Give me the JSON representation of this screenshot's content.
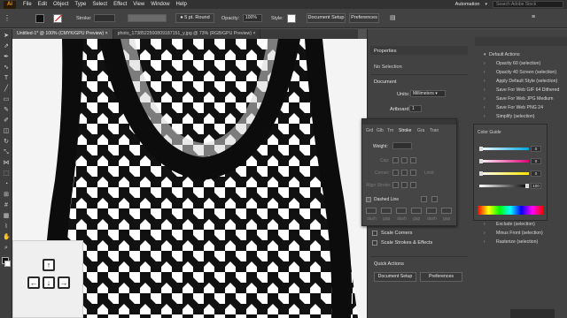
{
  "menu": {
    "logo": "Ai",
    "items": [
      "File",
      "Edit",
      "Object",
      "Type",
      "Select",
      "Effect",
      "View",
      "Window",
      "Help"
    ],
    "workspace": "Automation",
    "search_placeholder": "Search Adobe Stock"
  },
  "control": {
    "stroke_label": "Stroke:",
    "brush_value": "5 pt. Round",
    "opacity_label": "Opacity:",
    "opacity_value": "100%",
    "style_label": "Style:",
    "document_setup": "Document Setup",
    "preferences": "Preferences"
  },
  "tabs": [
    {
      "label": "Untitled-1* @ 100% (CMYK/GPU Preview)",
      "active": true
    },
    {
      "label": "photo_1738522500809187151_y.jpg @ 73% (RGB/GPU Preview)",
      "active": false
    }
  ],
  "properties": {
    "tab": "Properties",
    "no_selection": "No Selection",
    "document_label": "Document",
    "units_label": "Units:",
    "units_value": "Millimeters",
    "artboard_label": "Artboard:",
    "artboard_value": "1",
    "scale_corners": "Scale Corners",
    "scale_strokes": "Scale Strokes & Effects",
    "quick_actions": "Quick Actions",
    "document_setup_btn": "Document Setup",
    "preferences_btn": "Preferences"
  },
  "actions_panel": {
    "header": "Default Actions",
    "items": [
      "Opacity 60 (selection)",
      "Opacity 40 Screen (selection)",
      "Apply Default Style (selection)",
      "Save For Web GIF 64 Dithered",
      "Save For Web JPG Medium",
      "Save For Web PNG 24",
      "Simplify (selection)"
    ],
    "items_lower": [
      "Exclude (selection)",
      "Minus Front (selection)",
      "Rasterize (selection)"
    ]
  },
  "stroke_panel": {
    "tabs": [
      "Grd",
      "Glb",
      "Trn",
      "Stroke",
      "Gra",
      "Tran"
    ],
    "weight_label": "Weight:",
    "cap_label": "Cap:",
    "corner_label": "Corner:",
    "limit_label": "Limit:",
    "align_label": "Align Stroke:",
    "dashed_label": "Dashed Line",
    "dash_labels": [
      "dash",
      "gap",
      "dash",
      "gap",
      "dash",
      "gap"
    ]
  },
  "color_panel": {
    "title": "Color Guide",
    "values": [
      "0",
      "0",
      "0",
      "100"
    ]
  },
  "colors": {
    "accent": "#ff9a00",
    "selected_blue": "#1473e6"
  }
}
